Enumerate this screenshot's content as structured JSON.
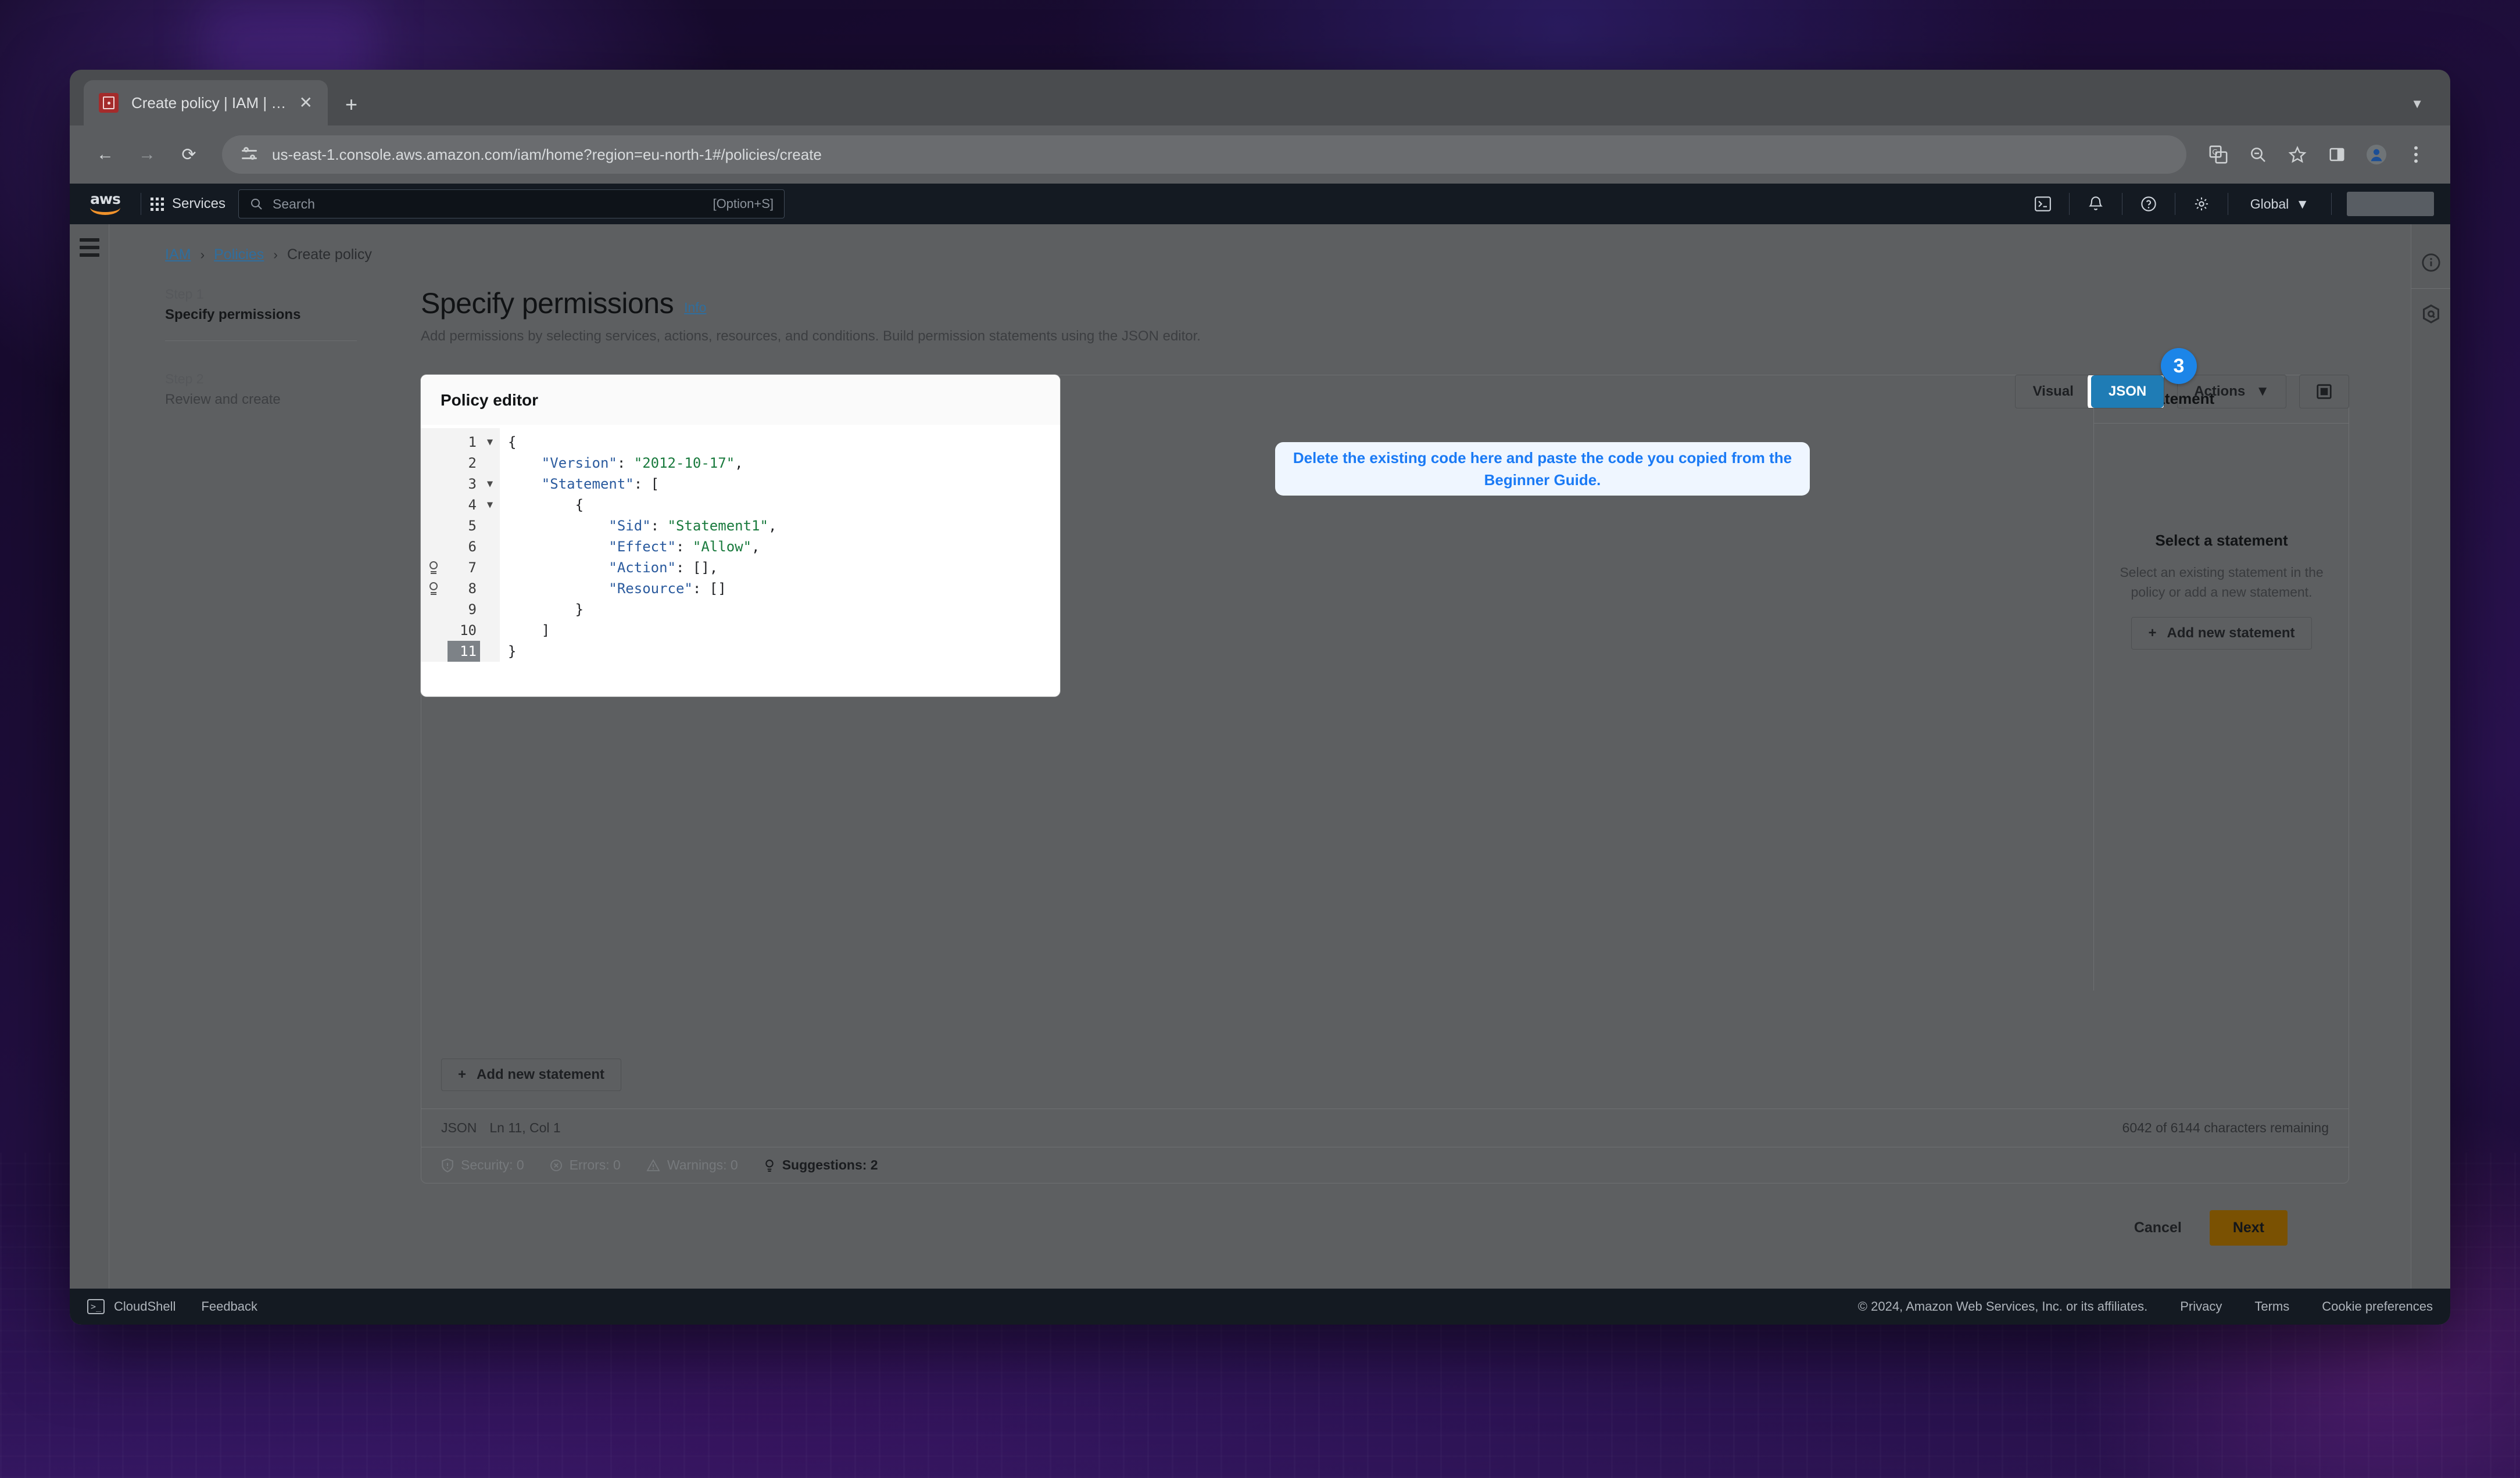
{
  "browser": {
    "tab": {
      "title": "Create policy | IAM | Global",
      "favicon": "iam-policy-icon",
      "close": "✕"
    },
    "newtab_label": "+",
    "tabstrip_chevron": "▼",
    "nav": {
      "back": "←",
      "forward": "→",
      "reload": "⟳"
    },
    "url": "us-east-1.console.aws.amazon.com/iam/home?region=eu-north-1#/policies/create",
    "toolbar_icons": [
      "translate-icon",
      "zoom-out-icon",
      "bookmark-star-icon",
      "side-panel-icon",
      "profile-avatar-icon",
      "chrome-menu-icon"
    ]
  },
  "topnav": {
    "logo_word": "aws",
    "services_label": "Services",
    "search_placeholder": "Search",
    "search_shortcut": "[Option+S]",
    "icons": [
      "cloudshell-icon",
      "notifications-bell-icon",
      "help-question-icon",
      "settings-gear-icon"
    ],
    "region": "Global",
    "region_caret": "▼"
  },
  "breadcrumb": {
    "items": [
      "IAM",
      "Policies",
      "Create policy"
    ],
    "separator": "›"
  },
  "steps": [
    {
      "label": "Step 1",
      "name": "Specify permissions",
      "active": true
    },
    {
      "label": "Step 2",
      "name": "Review and create",
      "active": false
    }
  ],
  "page": {
    "title": "Specify permissions",
    "info_link": "Info",
    "subtitle": "Add permissions by selecting services, actions, resources, and conditions. Build permission statements using the JSON editor."
  },
  "editor": {
    "card_title": "Policy editor",
    "toggle": {
      "visual": "Visual",
      "json": "JSON",
      "selected": "JSON"
    },
    "actions_label": "Actions",
    "actions_caret": "▼",
    "view_icon": "split-view-icon",
    "add_statement_label": "Add new statement",
    "add_statement_plus": "+",
    "status": {
      "language": "JSON",
      "cursor": "Ln 11, Col 1",
      "characters": "6042 of 6144 characters remaining"
    },
    "chips": [
      {
        "label": "Security: 0",
        "icon": "shield-icon",
        "strong": false
      },
      {
        "label": "Errors: 0",
        "icon": "error-circle-icon",
        "strong": false
      },
      {
        "label": "Warnings: 0",
        "icon": "warning-triangle-icon",
        "strong": false
      },
      {
        "label": "Suggestions: 2",
        "icon": "lightbulb-icon",
        "strong": true
      }
    ],
    "code": {
      "language": "json",
      "current_line": 11,
      "fold_lines": [
        1,
        3,
        4
      ],
      "hint_lines": [
        7,
        8
      ],
      "lines": [
        {
          "n": 1,
          "text": "{"
        },
        {
          "n": 2,
          "text": "    \"Version\": \"2012-10-17\","
        },
        {
          "n": 3,
          "text": "    \"Statement\": ["
        },
        {
          "n": 4,
          "text": "        {"
        },
        {
          "n": 5,
          "text": "            \"Sid\": \"Statement1\","
        },
        {
          "n": 6,
          "text": "            \"Effect\": \"Allow\","
        },
        {
          "n": 7,
          "text": "            \"Action\": [],"
        },
        {
          "n": 8,
          "text": "            \"Resource\": []"
        },
        {
          "n": 9,
          "text": "        }"
        },
        {
          "n": 10,
          "text": "    ]"
        },
        {
          "n": 11,
          "text": "}"
        }
      ]
    }
  },
  "side_panel": {
    "title": "Edit statement",
    "empty_title": "Select a statement",
    "empty_body": "Select an existing statement in the policy or add a new statement.",
    "add_button": "Add new statement",
    "add_plus": "+"
  },
  "callout": {
    "badge": "3",
    "text": "Delete the existing code here and paste the code you copied from the Beginner Guide."
  },
  "footer_actions": {
    "cancel": "Cancel",
    "next": "Next"
  },
  "console_footer": {
    "cloudshell": "CloudShell",
    "feedback": "Feedback",
    "copyright": "© 2024, Amazon Web Services, Inc. or its affiliates.",
    "links": [
      "Privacy",
      "Terms",
      "Cookie preferences"
    ]
  },
  "colors": {
    "accent_blue": "#1f7cb5",
    "callout_blue": "#1a7af5",
    "next_orange": "#7a5102",
    "nav_dark": "#141a22",
    "link": "#2f6e9e"
  }
}
